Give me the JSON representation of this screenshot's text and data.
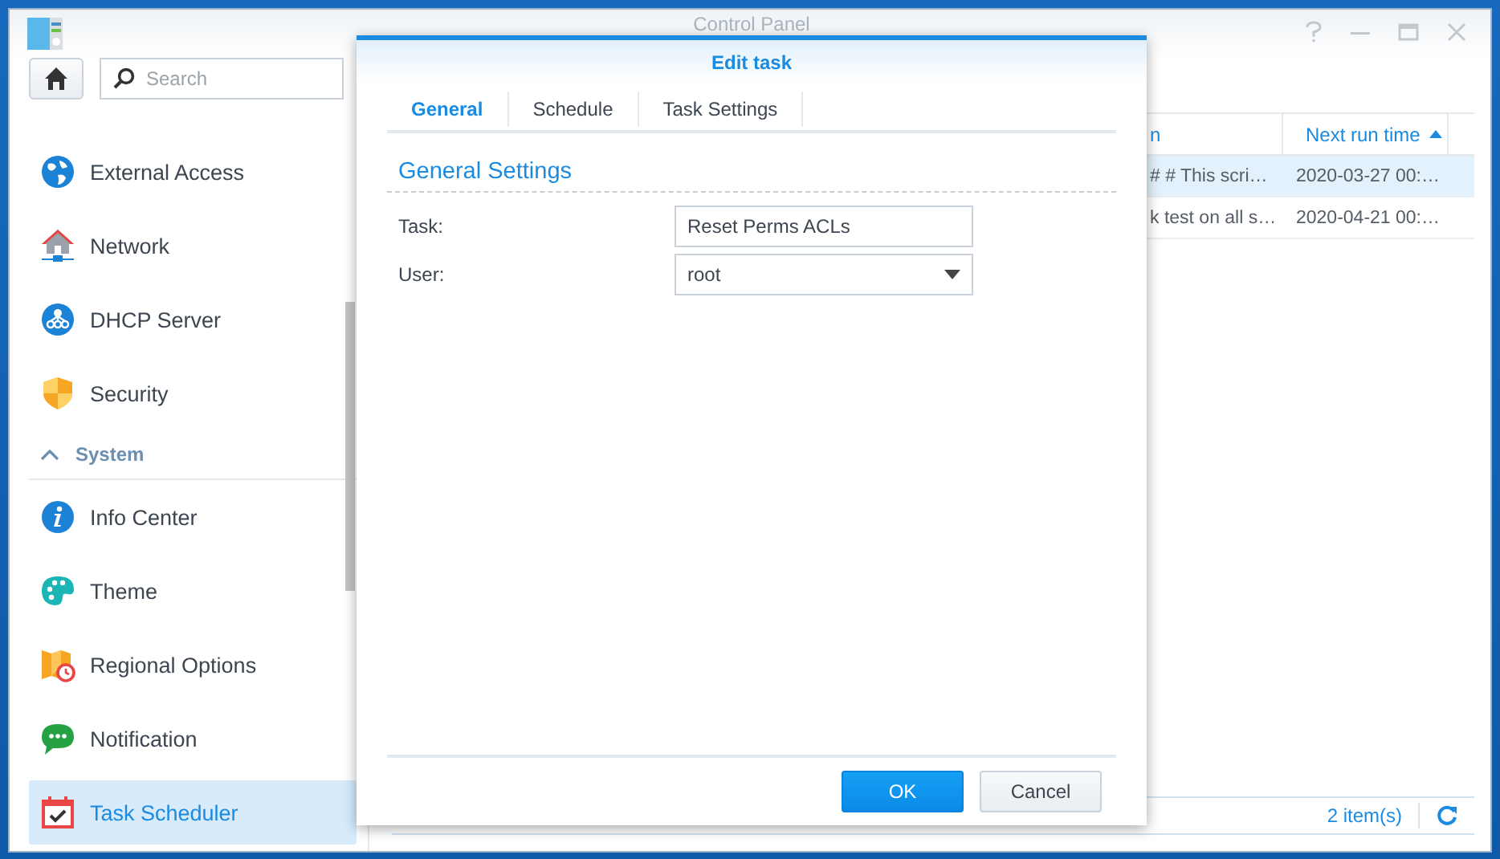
{
  "window": {
    "title": "Control Panel"
  },
  "sidebar": {
    "search": {
      "placeholder": "Search"
    },
    "items": [
      {
        "kind": "item",
        "label": "External Access",
        "selected": false
      },
      {
        "kind": "item",
        "label": "Network",
        "selected": false
      },
      {
        "kind": "item",
        "label": "DHCP Server",
        "selected": false
      },
      {
        "kind": "item",
        "label": "Security",
        "selected": false
      },
      {
        "kind": "section",
        "label": "System",
        "expanded": true
      },
      {
        "kind": "item",
        "label": "Info Center",
        "selected": false
      },
      {
        "kind": "item",
        "label": "Theme",
        "selected": false
      },
      {
        "kind": "item",
        "label": "Regional Options",
        "selected": false
      },
      {
        "kind": "item",
        "label": "Notification",
        "selected": false
      },
      {
        "kind": "item",
        "label": "Task Scheduler",
        "selected": true
      }
    ]
  },
  "table": {
    "columns": [
      {
        "label": "n",
        "sorted": false
      },
      {
        "label": "Next run time",
        "sorted": true
      }
    ],
    "rows": [
      {
        "cells": [
          "# # This scri…",
          "2020-03-27 00:…"
        ],
        "selected": true
      },
      {
        "cells": [
          "k test on all s…",
          "2020-04-21 00:…"
        ],
        "selected": false
      }
    ]
  },
  "footer": {
    "count": "2 item(s)"
  },
  "dialog": {
    "title": "Edit task",
    "tabs": [
      {
        "label": "General",
        "selected": true
      },
      {
        "label": "Schedule",
        "selected": false
      },
      {
        "label": "Task Settings",
        "selected": false
      }
    ],
    "section": "General Settings",
    "fields": [
      {
        "kind": "text",
        "label": "Task:",
        "value": "Reset Perms ACLs"
      },
      {
        "kind": "select",
        "label": "User:",
        "value": "root"
      }
    ],
    "buttons": [
      {
        "kind": "primary",
        "label": "OK"
      },
      {
        "kind": "secondary",
        "label": "Cancel"
      }
    ]
  }
}
